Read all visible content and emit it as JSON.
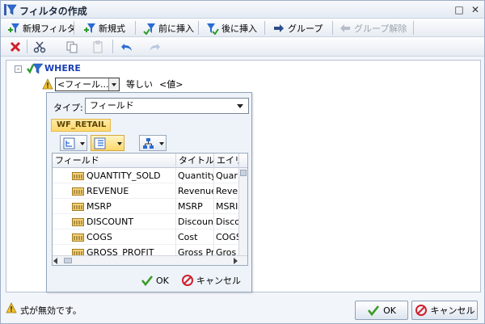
{
  "window": {
    "title": "フィルタの作成",
    "min_glyph": "□",
    "close_glyph": "✕"
  },
  "toolbar": {
    "new_filter": "新規フィルタ",
    "new_expression": "新規式",
    "insert_before": "前に挿入",
    "insert_after": "後に挿入",
    "group": "グループ",
    "ungroup": "グループ解除"
  },
  "tree": {
    "expander": "⊟",
    "root_label": "WHERE",
    "condition": {
      "field": "<フィール...",
      "operator": "等しい",
      "value": "<値>"
    }
  },
  "panel": {
    "type_label": "タイプ:",
    "type_value": "フィールド",
    "source_tab": "WF_RETAIL",
    "columns": [
      "フィールド",
      "タイトル",
      "エイリ"
    ],
    "rows": [
      {
        "field": "QUANTITY_SOLD",
        "title": "Quantity,",
        "alias": "Quar"
      },
      {
        "field": "REVENUE",
        "title": "Revenue",
        "alias": "Reve"
      },
      {
        "field": "MSRP",
        "title": "MSRP",
        "alias": "MSRI"
      },
      {
        "field": "DISCOUNT",
        "title": "Discount",
        "alias": "Disco"
      },
      {
        "field": "COGS",
        "title": "Cost",
        "alias": "COGS"
      },
      {
        "field": "GROSS_PROFIT",
        "title": "Gross Pr",
        "alias": "Gros"
      }
    ],
    "ok_label": "OK",
    "cancel_label": "キャンセル"
  },
  "status": {
    "message": "式が無効です。",
    "ok_label": "OK",
    "cancel_label": "キャンセル"
  },
  "colors": {
    "accent": "#1a3fb5",
    "ok_green": "#3a9b23",
    "cancel_red": "#d0202a",
    "warning": "#f2c12e"
  },
  "icons": {
    "filter": "filter-funnel-icon",
    "new_filter": "new-filter-icon",
    "new_expression": "new-expression-icon",
    "insert_before": "insert-before-icon",
    "insert_after": "insert-after-icon",
    "group": "group-arrow-icon",
    "ungroup": "ungroup-arrow-icon",
    "delete": "delete-x-icon",
    "cut": "scissors-icon",
    "copy": "copy-icon",
    "paste": "paste-icon",
    "undo": "undo-icon",
    "redo": "redo-icon",
    "warning": "warning-icon",
    "ok": "checkmark-icon",
    "cancel": "cancel-circle-icon"
  }
}
